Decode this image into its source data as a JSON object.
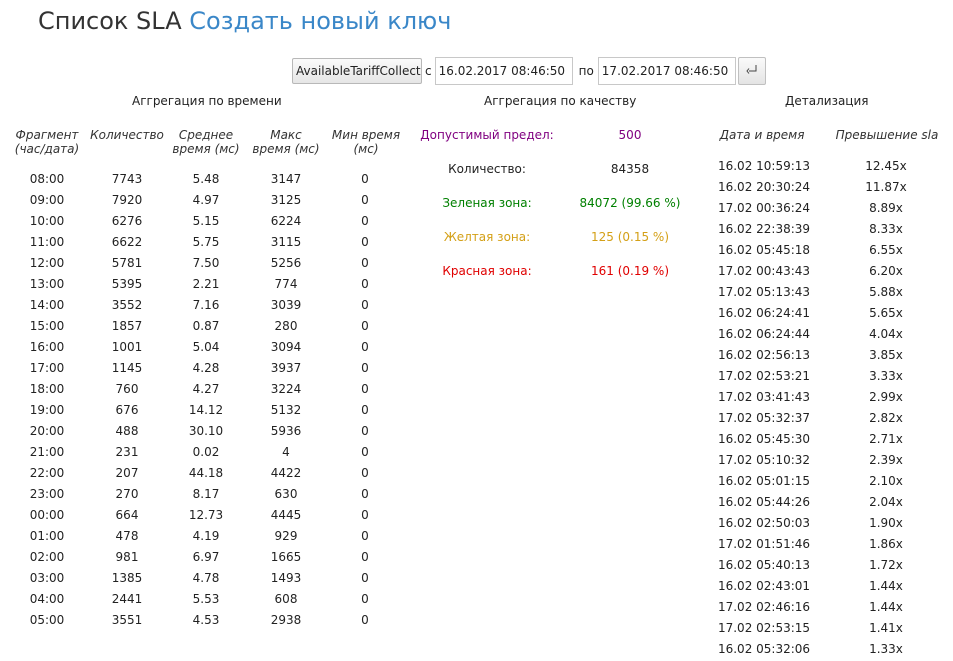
{
  "header": {
    "title": "Список SLA",
    "create_link": "Создать новый ключ"
  },
  "filter": {
    "method": "AvailableTariffCollect",
    "from_label": "с",
    "from_value": "16.02.2017 08:46:50",
    "to_label": "по",
    "to_value": "17.02.2017 08:46:50",
    "submit_icon": "enter-icon"
  },
  "time_aggregation": {
    "title": "Аггрегация по времени",
    "columns": {
      "fragment": "Фрагмент (час/дата)",
      "count": "Количество",
      "avg": "Среднее время (мс)",
      "max": "Макс время (мс)",
      "min": "Мин время (мс)"
    },
    "rows": [
      [
        "08:00",
        "7743",
        "5.48",
        "3147",
        "0"
      ],
      [
        "09:00",
        "7920",
        "4.97",
        "3125",
        "0"
      ],
      [
        "10:00",
        "6276",
        "5.15",
        "6224",
        "0"
      ],
      [
        "11:00",
        "6622",
        "5.75",
        "3115",
        "0"
      ],
      [
        "12:00",
        "5781",
        "7.50",
        "5256",
        "0"
      ],
      [
        "13:00",
        "5395",
        "2.21",
        "774",
        "0"
      ],
      [
        "14:00",
        "3552",
        "7.16",
        "3039",
        "0"
      ],
      [
        "15:00",
        "1857",
        "0.87",
        "280",
        "0"
      ],
      [
        "16:00",
        "1001",
        "5.04",
        "3094",
        "0"
      ],
      [
        "17:00",
        "1145",
        "4.28",
        "3937",
        "0"
      ],
      [
        "18:00",
        "760",
        "4.27",
        "3224",
        "0"
      ],
      [
        "19:00",
        "676",
        "14.12",
        "5132",
        "0"
      ],
      [
        "20:00",
        "488",
        "30.10",
        "5936",
        "0"
      ],
      [
        "21:00",
        "231",
        "0.02",
        "4",
        "0"
      ],
      [
        "22:00",
        "207",
        "44.18",
        "4422",
        "0"
      ],
      [
        "23:00",
        "270",
        "8.17",
        "630",
        "0"
      ],
      [
        "00:00",
        "664",
        "12.73",
        "4445",
        "0"
      ],
      [
        "01:00",
        "478",
        "4.19",
        "929",
        "0"
      ],
      [
        "02:00",
        "981",
        "6.97",
        "1665",
        "0"
      ],
      [
        "03:00",
        "1385",
        "4.78",
        "1493",
        "0"
      ],
      [
        "04:00",
        "2441",
        "5.53",
        "608",
        "0"
      ],
      [
        "05:00",
        "3551",
        "4.53",
        "2938",
        "0"
      ]
    ]
  },
  "quality_aggregation": {
    "title": "Аггрегация по качеству",
    "rows": [
      {
        "label": "Допустимый предел:",
        "value": "500",
        "color": "#800080"
      },
      {
        "label": "Количество:",
        "value": "84358",
        "color": "#222222"
      },
      {
        "label": "Зеленая зона:",
        "value": "84072 (99.66 %)",
        "color": "#008000"
      },
      {
        "label": "Желтая зона:",
        "value": "125 (0.15 %)",
        "color": "#d4a017"
      },
      {
        "label": "Красная зона:",
        "value": "161 (0.19 %)",
        "color": "#e00000"
      }
    ]
  },
  "details": {
    "title": "Детализация",
    "columns": {
      "datetime": "Дата и время",
      "excess": "Превышение sla"
    },
    "rows": [
      [
        "16.02 10:59:13",
        "12.45x"
      ],
      [
        "16.02 20:30:24",
        "11.87x"
      ],
      [
        "17.02 00:36:24",
        "8.89x"
      ],
      [
        "16.02 22:38:39",
        "8.33x"
      ],
      [
        "16.02 05:45:18",
        "6.55x"
      ],
      [
        "17.02 00:43:43",
        "6.20x"
      ],
      [
        "17.02 05:13:43",
        "5.88x"
      ],
      [
        "16.02 06:24:41",
        "5.65x"
      ],
      [
        "16.02 06:24:44",
        "4.04x"
      ],
      [
        "16.02 02:56:13",
        "3.85x"
      ],
      [
        "17.02 02:53:21",
        "3.33x"
      ],
      [
        "17.02 03:41:43",
        "2.99x"
      ],
      [
        "17.02 05:32:37",
        "2.82x"
      ],
      [
        "16.02 05:45:30",
        "2.71x"
      ],
      [
        "17.02 05:10:32",
        "2.39x"
      ],
      [
        "16.02 05:01:15",
        "2.10x"
      ],
      [
        "16.02 05:44:26",
        "2.04x"
      ],
      [
        "16.02 02:50:03",
        "1.90x"
      ],
      [
        "17.02 01:51:46",
        "1.86x"
      ],
      [
        "16.02 05:40:13",
        "1.72x"
      ],
      [
        "16.02 02:43:01",
        "1.44x"
      ],
      [
        "17.02 02:46:16",
        "1.44x"
      ],
      [
        "17.02 02:53:15",
        "1.41x"
      ],
      [
        "16.02 05:32:06",
        "1.33x"
      ]
    ]
  }
}
